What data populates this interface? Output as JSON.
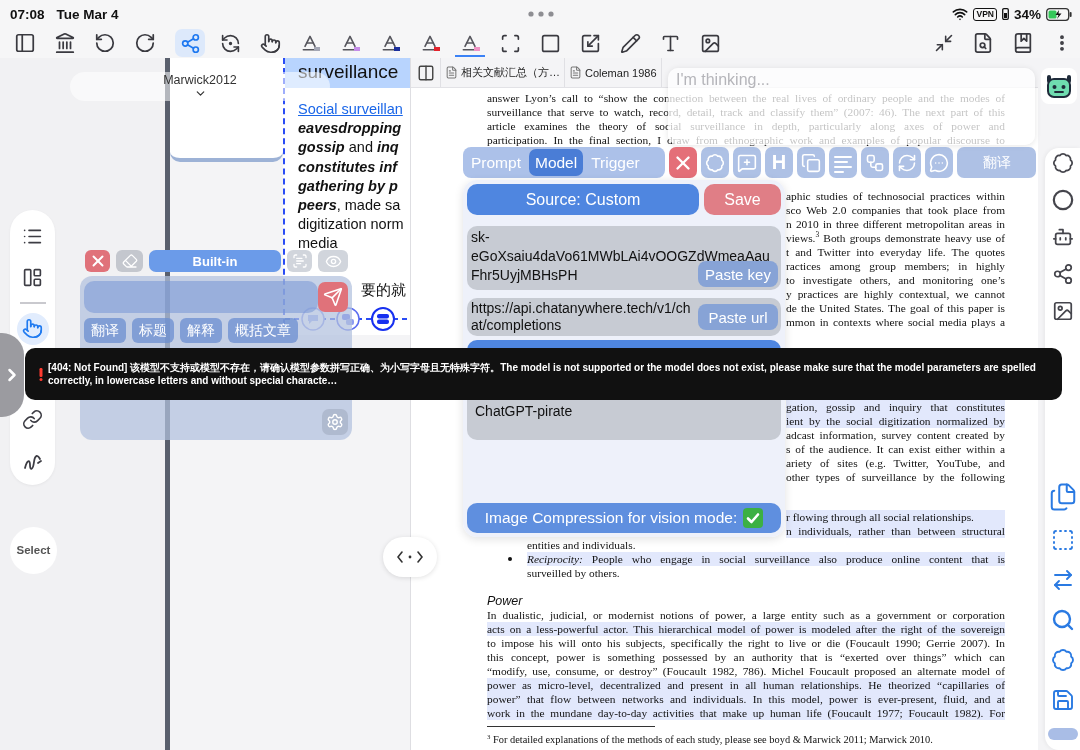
{
  "status_bar": {
    "time": "07:08",
    "date": "Tue Mar 4",
    "vpn": "VPN",
    "battery": "34%"
  },
  "toolbar": {
    "tools": [
      {
        "kind": "tool",
        "selected": true
      },
      {
        "kind": "tool",
        "selected": false
      },
      {
        "kind": "tool",
        "selected": false
      },
      {
        "kind": "pen",
        "color": "#a3a6b4",
        "selected": false
      },
      {
        "kind": "pen",
        "color": "#c48ce8",
        "selected": false
      },
      {
        "kind": "pen",
        "color": "#1c2f9c",
        "selected": false
      },
      {
        "kind": "pen",
        "color": "#e3232c",
        "selected": false
      },
      {
        "kind": "pen",
        "color": "#f093c4",
        "selected": true
      },
      {
        "kind": "tool",
        "selected": false
      },
      {
        "kind": "tool",
        "selected": false
      },
      {
        "kind": "tool",
        "selected": false
      },
      {
        "kind": "tool",
        "selected": false
      },
      {
        "kind": "tool",
        "selected": false
      },
      {
        "kind": "tool",
        "selected": false
      }
    ]
  },
  "left_rail": {
    "tools": [
      {
        "selected": false
      },
      {
        "selected": false
      },
      {
        "selected": true
      },
      {
        "selected": false
      },
      {
        "selected": false
      }
    ],
    "select": "Select"
  },
  "canvas": {
    "switcher": "Marwick2012",
    "note": {
      "title": "surveillance",
      "lines": [
        {
          "kind": "link",
          "text": "Social surveillan"
        },
        {
          "kind": "emphasis",
          "text": "eavesdropping"
        },
        {
          "kind": "text",
          "text": "**gossip** and **inq**"
        },
        {
          "kind": "emphasis",
          "text": "constitutes inf"
        },
        {
          "kind": "emphasis",
          "text": "gathering by p"
        },
        {
          "kind": "text",
          "text": "**peers**, made sa"
        },
        {
          "kind": "text",
          "text": "digitization norm"
        },
        {
          "kind": "text",
          "text": "media"
        }
      ],
      "reply": "要的就"
    }
  },
  "assistant": {
    "mode": "Built-in",
    "chips": [
      "翻译",
      "标题",
      "解释",
      "概括文章"
    ]
  },
  "document_tabs": [
    {
      "label": "相关文献汇总（方…",
      "selected": false
    },
    {
      "label": "Coleman 1986",
      "selected": false
    }
  ],
  "document": {
    "blocks": [
      {
        "kind": "text",
        "ends": false,
        "lines": [
          {
            "text": "answer Lyon’s call to “show the connection between the real lives of ordinary people and the modes of",
            "highlighted": false
          },
          {
            "text": "surveillance that serve to watch, record, detail, track and classify them” (2007: 46). The next part of this",
            "highlighted": false
          },
          {
            "text": "article examines the theory of social surveillance in depth, particularly along axes of power and",
            "highlighted": false
          },
          {
            "text": "participation. In the final section, I draw from ethnographic work and examples of popular discourse to",
            "highlighted": false
          }
        ]
      },
      {
        "kind": "cut",
        "ends": false,
        "lines": [
          {
            "text": "aphic studies of technosocial practices within",
            "highlighted": false
          },
          {
            "text": "sco Web 2.0 companies that took place from",
            "highlighted": false
          },
          {
            "text": "n 2010 in three different metropolitan areas in",
            "highlighted": false
          },
          {
            "text": "views.$^{3}$ Both groups demonstrate heavy use of",
            "highlighted": false
          },
          {
            "text": "t and Twitter into everyday life. The quotes",
            "highlighted": false
          },
          {
            "text": "ractices among group members; in highly",
            "highlighted": false
          },
          {
            "text": "to investigate others, and monitoring one’s",
            "highlighted": false
          },
          {
            "text": "y practices are highly contextual, we cannot",
            "highlighted": false
          },
          {
            "text": "de the United States. The goal of this paper is",
            "highlighted": false
          },
          {
            "text": "mmon in contexts where social media plays a",
            "highlighted": false
          }
        ]
      },
      {
        "kind": "cut",
        "ends": false,
        "lines": [
          {
            "text": "gation, gossip and inquiry that constitutes",
            "highlighted": true
          },
          {
            "text": "ient by the social digitization normalized by",
            "highlighted": true
          },
          {
            "text": "adcast information, survey content created by",
            "highlighted": false
          },
          {
            "text": "s of the audience. It can exist either within a",
            "highlighted": false
          },
          {
            "text": "ariety of sites (e.g. Twitter, YouTube, and",
            "highlighted": false
          },
          {
            "text": "other types of surveillance by the following",
            "highlighted": false
          }
        ]
      },
      {
        "kind": "cut",
        "ends": true,
        "lines": [
          {
            "text": "r flowing through all social relationships.",
            "highlighted": true
          }
        ]
      },
      {
        "kind": "cut",
        "ends": false,
        "lines": [
          {
            "text": "n individuals, rather than between structural",
            "highlighted": true
          }
        ]
      },
      {
        "kind": "indent",
        "ends": true,
        "lines": [
          {
            "text": "entities and individuals.",
            "highlighted": false
          }
        ]
      },
      {
        "kind": "bullet",
        "ends": true,
        "lines": [
          {
            "text": "*Reciprocity:* People who engage in social surveillance also produce online content that is",
            "highlighted": true
          },
          {
            "text": "surveilled by others.",
            "highlighted": false
          }
        ]
      },
      {
        "kind": "heading",
        "text": "Power"
      },
      {
        "kind": "text",
        "ends": false,
        "lines": [
          {
            "text": "In dualistic, judicial, or modernist notions of power, a large entity such as a government or corporation",
            "highlighted": false
          },
          {
            "text": "acts on a less-powerful actor. This hierarchical model of power is modeled after the right of the sovereign",
            "highlighted": true
          },
          {
            "text": "to impose his will onto his subjects, specifically the right to live or die (Foucault 1990; Gerrie 2007). In",
            "highlighted": false
          },
          {
            "text": "this concept, power is something possessed by an authority that is “exerted over things” which can",
            "highlighted": false
          },
          {
            "text": "“modify, use, consume, or destroy” (Foucault 1982, 786). Michel Foucault proposed an alternate model of",
            "highlighted": false
          },
          {
            "text": "power as micro-level, decentralized and present in all human relationships. He theorized “capillaries of",
            "highlighted": true
          },
          {
            "text": "power” that flow between networks and individuals. In this model, power is ever-present, fluid, and at",
            "highlighted": true
          },
          {
            "text": "work in the mundane day-to-day activities that make up human life (Foucault 1977; Foucault 1982). For",
            "highlighted": true
          }
        ]
      },
      {
        "kind": "footnote",
        "text": "$^{3}$ For detailed explanations of the methods of each study, please see boyd & Marwick 2011; Marwick 2010."
      }
    ]
  },
  "thinking": {
    "placeholder": "I'm thinking..."
  },
  "ai_toolbar": {
    "tabs": [
      {
        "label": "Prompt",
        "selected": false
      },
      {
        "label": "Model",
        "selected": true
      },
      {
        "label": "Trigger",
        "selected": false
      }
    ],
    "heading": "H",
    "translate": "翻译"
  },
  "model_panel": {
    "source": "Source: Custom",
    "save": "Save",
    "api_key": "sk-eGoXsaiu4daVo61MWbLAi4vOOGZdWmeaAauFhr5UyjMBHsPH",
    "paste_key": "Paste key",
    "api_url": "https://api.chatanywhere.tech/v1/chat/completions",
    "paste_url": "Paste url",
    "models": [
      "ChatGPT-pirate"
    ],
    "image_compression": {
      "label": "Image Compression for vision mode:",
      "on": true
    }
  },
  "error_toast": {
    "message": "[404: Not Found] 该模型不支持或模型不存在，请确认模型参数拼写正确、为小写字母且无特殊字符。The model is not supported or the model does not exist, please make sure that the model parameters are spelled correctly, in lowercase letters and without special characte…"
  }
}
